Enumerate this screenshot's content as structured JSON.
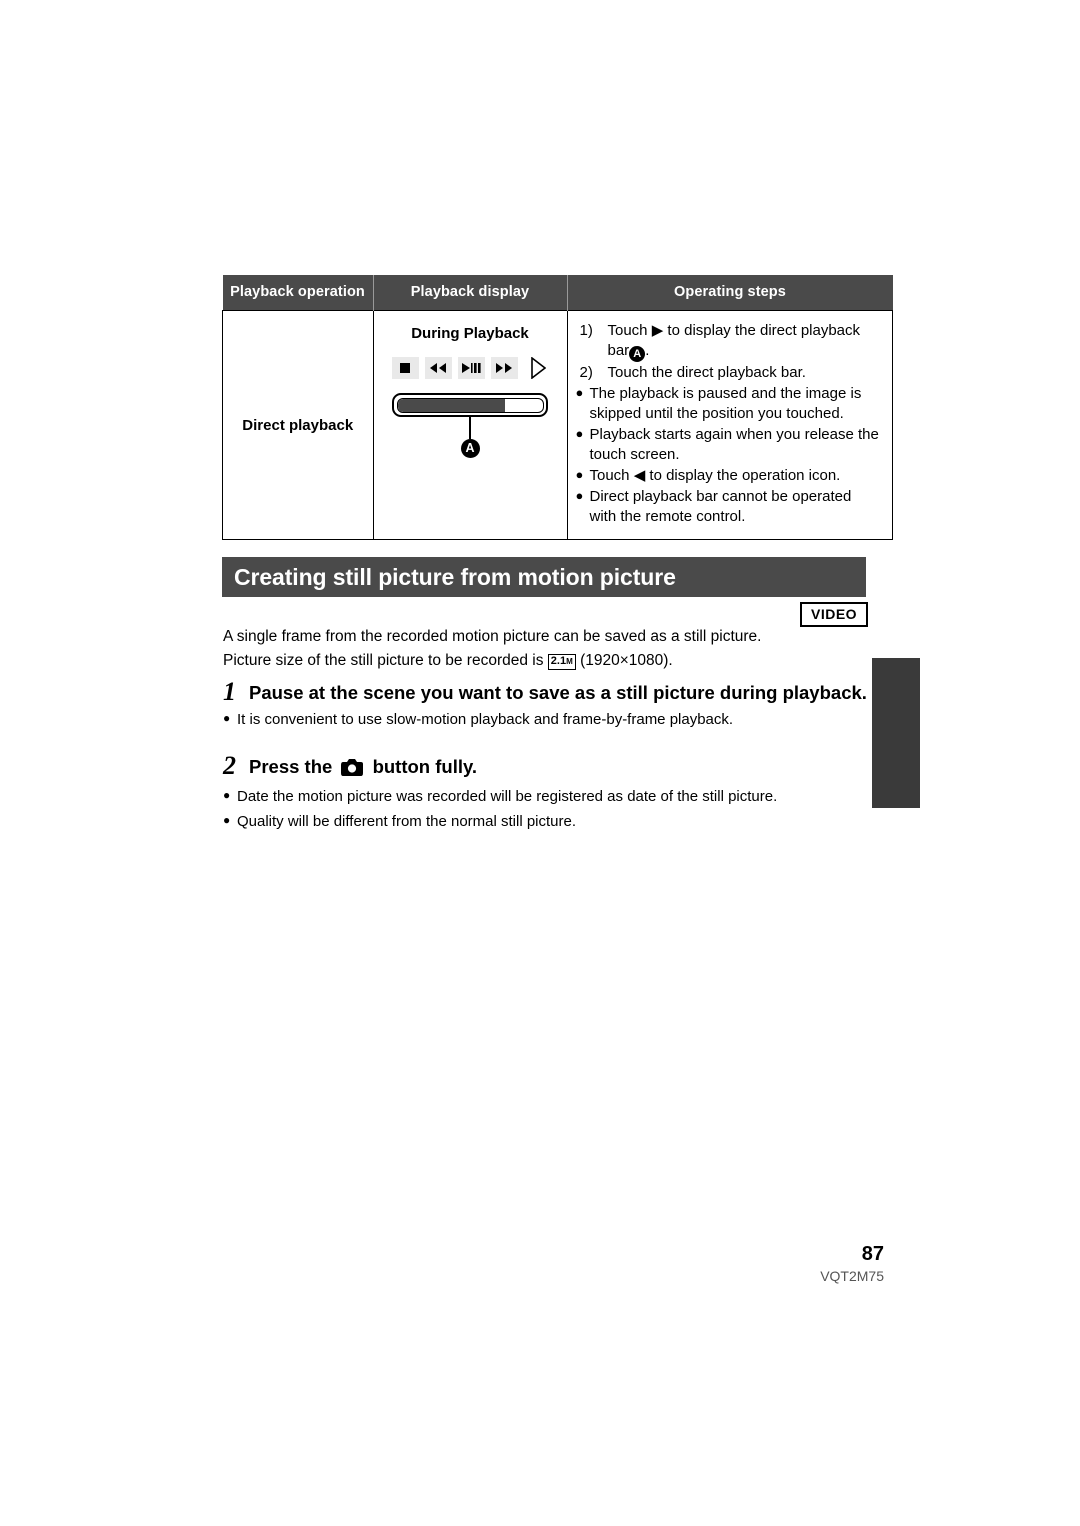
{
  "table": {
    "headers": [
      "Playback operation",
      "Playback display",
      "Operating steps"
    ],
    "row": {
      "operation": "Direct playback",
      "display": {
        "title": "During Playback",
        "icons": [
          "stop-icon",
          "rewind-icon",
          "play-pause-icon",
          "fast-forward-icon",
          "triangle-outline-icon"
        ],
        "callout_label": "A",
        "progress_percent": 74
      },
      "steps": {
        "numbered": [
          {
            "marker": "1)",
            "text_before": "Touch",
            "symbol": "▶",
            "text_after": "to display the direct playback bar",
            "callout": "A",
            "text_end": "."
          },
          {
            "marker": "2)",
            "text": "Touch the direct playback bar."
          }
        ],
        "bullets": [
          "The playback is paused and the image is skipped until the position you touched.",
          "Playback starts again when you release the touch screen.",
          "Touch ◀ to display the operation icon.",
          "Direct playback bar cannot be operated with the remote control."
        ]
      }
    }
  },
  "section": {
    "heading": "Creating still picture from motion picture",
    "badge": "VIDEO"
  },
  "intro": {
    "line1": "A single frame from the recorded motion picture can be saved as a still picture.",
    "line2_before": "Picture size of the still picture to be recorded is",
    "size_value": "2.1",
    "size_unit": "M",
    "line2_after": "(1920×1080)."
  },
  "steps": [
    {
      "number": "1",
      "title": "Pause at the scene you want to save as a still picture during playback.",
      "notes": [
        "It is convenient to use slow-motion playback and frame-by-frame playback."
      ]
    },
    {
      "number": "2",
      "title_before": "Press the",
      "icon": "camera-button-icon",
      "title_after": "button fully.",
      "notes": [
        "Date the motion picture was recorded will be registered as date of the still picture.",
        "Quality will be different from the normal still picture."
      ]
    }
  ],
  "footer": {
    "page_number": "87",
    "document_code": "VQT2M75"
  },
  "colors": {
    "header_gray": "#4a4a4a",
    "edge_tab": "#3a3a3a",
    "icon_button_bg": "#e9e9e9"
  }
}
